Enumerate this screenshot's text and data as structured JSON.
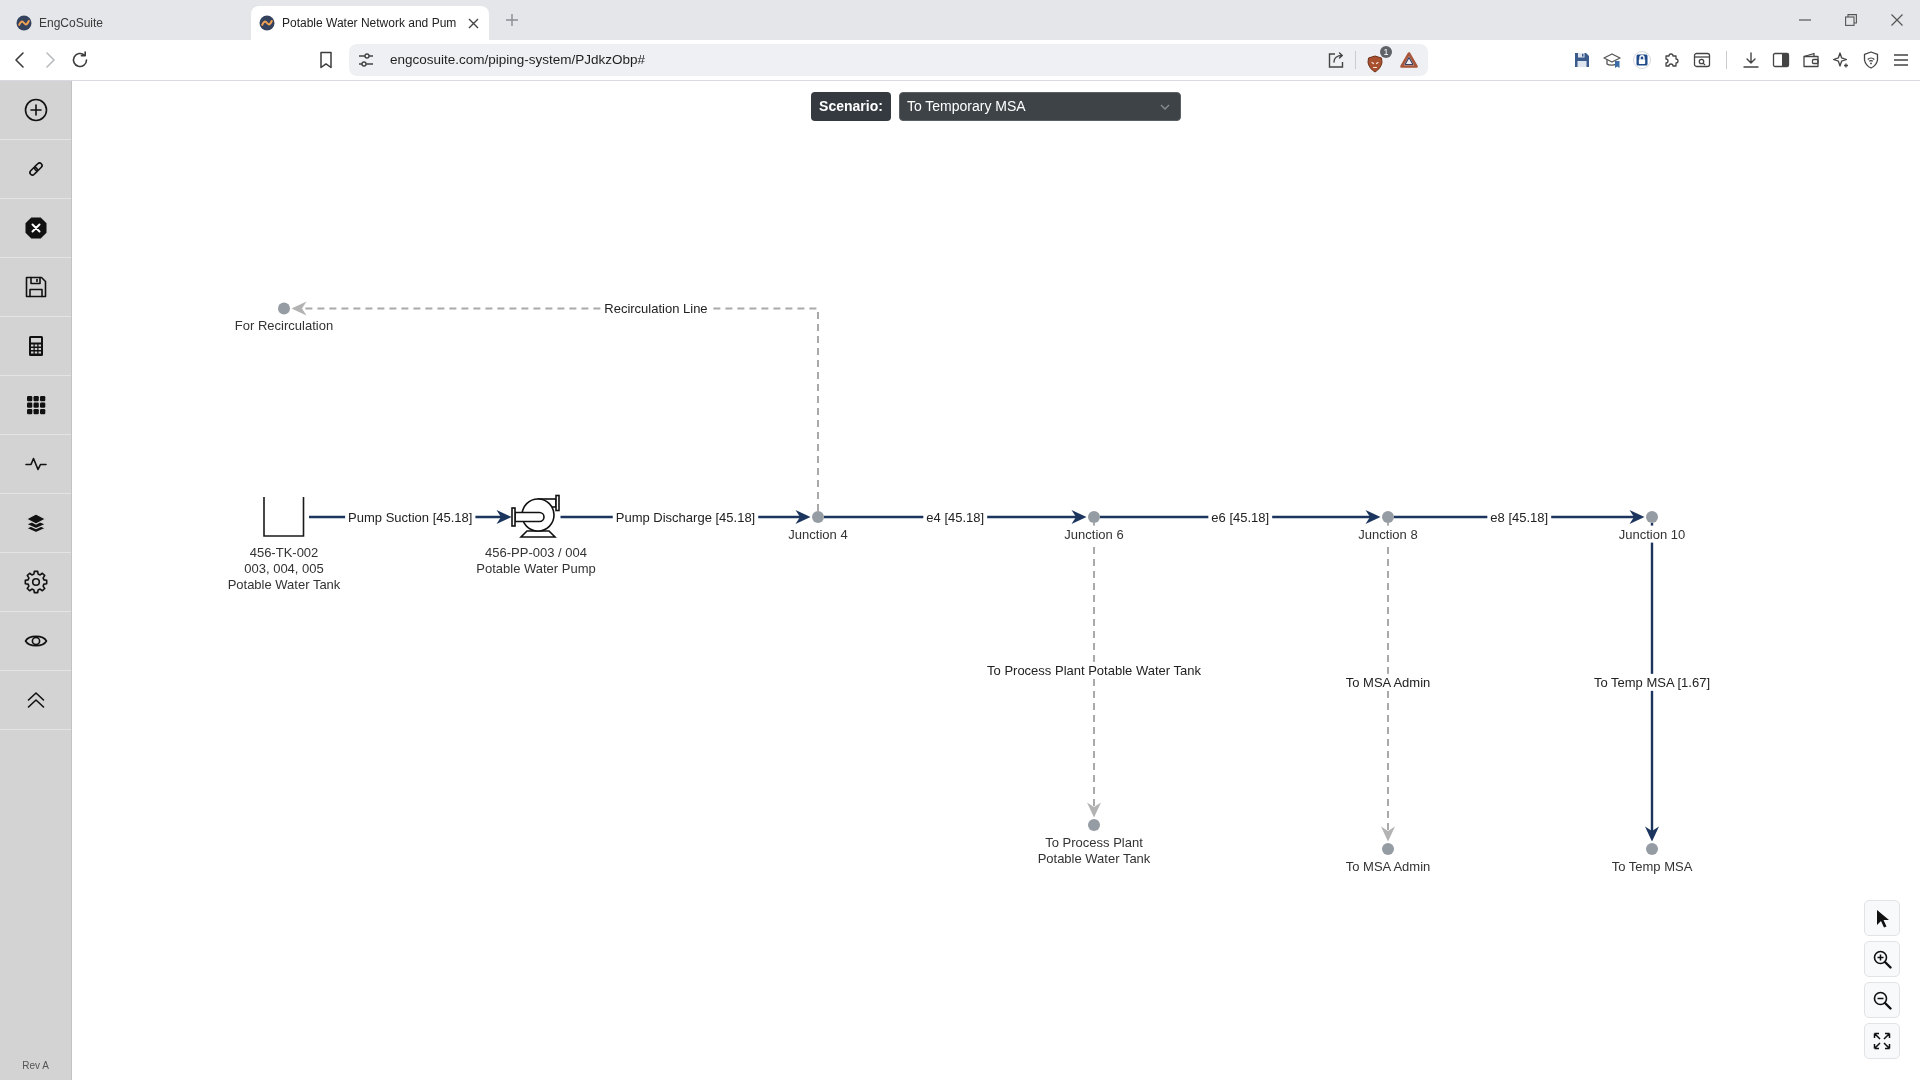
{
  "browser": {
    "tabs": [
      {
        "title": "EngCoSuite",
        "selected": false
      },
      {
        "title": "Potable Water Network and Pum",
        "selected": true
      }
    ],
    "forward": {
      "disabled": true
    },
    "address": "engcosuite.com/piping-system/PJdkzObp#",
    "shield_badge": "1"
  },
  "sidebar": {
    "footer": "Rev A"
  },
  "scenario": {
    "label": "Scenario:",
    "value": "To Temporary MSA"
  },
  "network": {
    "kind": "tank",
    "label": [
      "456-TK-002",
      "003, 004, 005",
      "Potable Water Tank"
    ],
    "children": [
      {
        "inlet": {
          "label": "Pump Suction [45.18]",
          "active": true
        },
        "kind": "pump",
        "label": [
          "456-PP-003 / 004",
          "Potable Water Pump"
        ],
        "children": [
          {
            "inlet": {
              "label": "Pump Discharge [45.18]",
              "active": true
            },
            "kind": "point",
            "label": [
              "Junction 4"
            ],
            "children": [
              {
                "inlet": {
                  "label": "Recirculation Line",
                  "active": false
                },
                "kind": "point",
                "label": [
                  "For Recirculation"
                ]
              },
              {
                "inlet": {
                  "label": "e4 [45.18]",
                  "active": true
                },
                "kind": "point",
                "label": [
                  "Junction 6"
                ],
                "children": [
                  {
                    "inlet": {
                      "label": "To Process Plant Potable Water Tank",
                      "active": false
                    },
                    "kind": "point",
                    "label": [
                      "To Process Plant",
                      "Potable Water Tank"
                    ]
                  },
                  {
                    "inlet": {
                      "label": "e6 [45.18]",
                      "active": true
                    },
                    "kind": "point",
                    "label": [
                      "Junction 8"
                    ],
                    "children": [
                      {
                        "inlet": {
                          "label": "To MSA Admin",
                          "active": false
                        },
                        "kind": "point",
                        "label": [
                          "To MSA Admin"
                        ]
                      },
                      {
                        "inlet": {
                          "label": "e8 [45.18]",
                          "active": true
                        },
                        "kind": "point",
                        "label": [
                          "Junction 10"
                        ],
                        "children": [
                          {
                            "inlet": {
                              "label": "To Temp MSA [1.67]",
                              "active": true
                            },
                            "kind": "point",
                            "label": [
                              "To Temp MSA"
                            ]
                          }
                        ]
                      }
                    ]
                  }
                ]
              }
            ]
          }
        ]
      }
    ]
  }
}
